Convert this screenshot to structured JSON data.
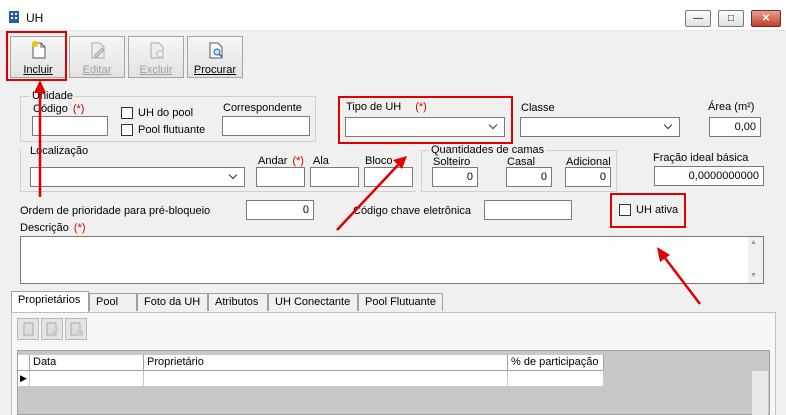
{
  "window": {
    "title": "UH"
  },
  "toolbar": {
    "incluir": "Incluir",
    "editar": "Editar",
    "excluir": "Excluir",
    "procurar": "Procurar"
  },
  "unidade": {
    "group_label": "Unidade",
    "codigo_label": "Código",
    "codigo_value": "",
    "uh_do_pool": "UH do pool",
    "pool_flutuante": "Pool flutuante",
    "correspondente_label": "Correspondente",
    "correspondente_value": ""
  },
  "required_mark": "(*)",
  "tipo_uh": {
    "label": "Tipo de UH",
    "value": ""
  },
  "classe": {
    "label": "Classe",
    "value": ""
  },
  "area": {
    "label": "Área (m²)",
    "value": "0,00"
  },
  "localizacao": {
    "label": "Localização",
    "value": ""
  },
  "andar": {
    "label": "Andar",
    "value": ""
  },
  "ala": {
    "label": "Ala",
    "value": ""
  },
  "bloco": {
    "label": "Bloco",
    "value": ""
  },
  "camas": {
    "group_label": "Quantidades de camas",
    "solteiro_label": "Solteiro",
    "solteiro_value": "0",
    "casal_label": "Casal",
    "casal_value": "0",
    "adicional_label": "Adicional",
    "adicional_value": "0"
  },
  "fracao": {
    "label": "Fração ideal básica",
    "value": "0,0000000000"
  },
  "prioridade": {
    "label": "Ordem de prioridade para pré-bloqueio",
    "value": "0"
  },
  "codigo_chave": {
    "label": "Código chave eletrônica",
    "value": ""
  },
  "uh_ativa": {
    "label": "UH ativa"
  },
  "descricao": {
    "label": "Descrição",
    "value": ""
  },
  "tabs": [
    {
      "label": "Proprietários"
    },
    {
      "label": "Pool"
    },
    {
      "label": "Foto da UH"
    },
    {
      "label": "Atributos"
    },
    {
      "label": "UH Conectante"
    },
    {
      "label": "Pool Flutuante"
    }
  ],
  "grid": {
    "columns": [
      "Data",
      "Proprietário",
      "% de participação"
    ]
  },
  "colors": {
    "annotation": "#e00000",
    "required": "#d00000"
  }
}
